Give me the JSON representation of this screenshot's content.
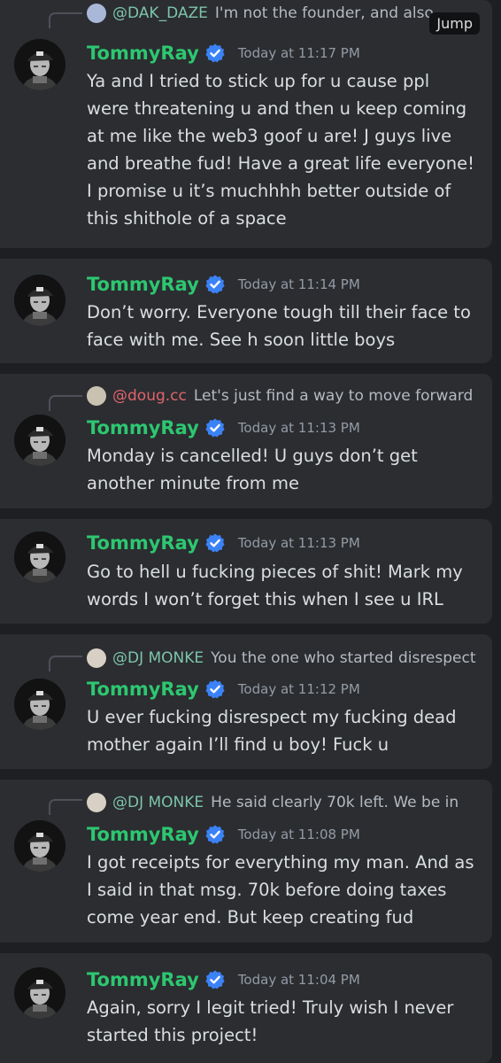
{
  "messages": [
    {
      "reply": {
        "name": "@DAK_DAZE",
        "text": "I'm not the founder, and also",
        "name_color": "#7dc4a8",
        "avatar_color": "#a9b7d8"
      },
      "jump": "Jump",
      "author": "TommyRay",
      "time": "Today at 11:17 PM",
      "text": "Ya and I tried to stick up for u cause ppl were threatening u and then u keep coming at me like the web3 goof u are! J guys live and breathe fud! Have a great life everyone! I promise u it’s muchhhh better outside of this shithole of a space"
    },
    {
      "author": "TommyRay",
      "time": "Today at 11:14 PM",
      "text": "Don’t worry. Everyone tough till their face to face with me. See h soon little boys"
    },
    {
      "reply": {
        "name": "@doug.cc",
        "text": "Let's just find a way to move forward",
        "name_color": "#e0646a",
        "avatar_color": "#c9c2b0"
      },
      "author": "TommyRay",
      "time": "Today at 11:13 PM",
      "text": "Monday is cancelled! U guys don’t get another minute from me"
    },
    {
      "author": "TommyRay",
      "time": "Today at 11:13 PM",
      "text": "Go to hell u fucking pieces of shit! Mark my words I won’t forget this when I see u IRL"
    },
    {
      "reply": {
        "name": "@DJ MONKE",
        "text": "You the one who started disrespect",
        "name_color": "#7dc4a8",
        "avatar_color": "#d8d0c4"
      },
      "author": "TommyRay",
      "time": "Today at 11:12 PM",
      "text": "U ever fucking disrespect my fucking dead mother again I’ll find u boy! Fuck u"
    },
    {
      "reply": {
        "name": "@DJ MONKE",
        "text": "He said clearly 70k left. We be in",
        "name_color": "#7dc4a8",
        "avatar_color": "#d8d0c4"
      },
      "author": "TommyRay",
      "time": "Today at 11:08 PM",
      "text": "I got receipts for everything my man. And as I said in that msg. 70k before doing taxes come year end. But keep creating fud"
    },
    {
      "author": "TommyRay",
      "time": "Today at 11:04 PM",
      "text": "Again, sorry I legit tried! Truly wish I never started this project!"
    }
  ]
}
